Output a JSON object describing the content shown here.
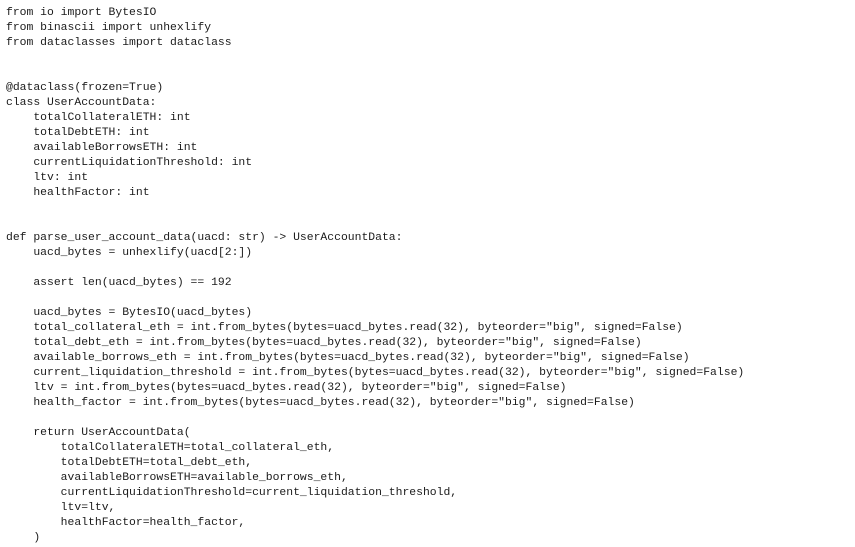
{
  "document": {
    "type": "source-code-listing",
    "language": "python",
    "background_color": "#ffffff",
    "text_color": "#1a1a1a",
    "font_size_px": 11.4,
    "line_height_px": 15,
    "indent_width_spaces": 4,
    "total_lines": 36,
    "code": {
      "lines": [
        "from io import BytesIO",
        "from binascii import unhexlify",
        "from dataclasses import dataclass",
        "",
        "",
        "@dataclass(frozen=True)",
        "class UserAccountData:",
        "    totalCollateralETH: int",
        "    totalDebtETH: int",
        "    availableBorrowsETH: int",
        "    currentLiquidationThreshold: int",
        "    ltv: int",
        "    healthFactor: int",
        "",
        "",
        "def parse_user_account_data(uacd: str) -> UserAccountData:",
        "    uacd_bytes = unhexlify(uacd[2:])",
        "",
        "    assert len(uacd_bytes) == 192",
        "",
        "    uacd_bytes = BytesIO(uacd_bytes)",
        "    total_collateral_eth = int.from_bytes(bytes=uacd_bytes.read(32), byteorder=\"big\", signed=False)",
        "    total_debt_eth = int.from_bytes(bytes=uacd_bytes.read(32), byteorder=\"big\", signed=False)",
        "    available_borrows_eth = int.from_bytes(bytes=uacd_bytes.read(32), byteorder=\"big\", signed=False)",
        "    current_liquidation_threshold = int.from_bytes(bytes=uacd_bytes.read(32), byteorder=\"big\", signed=False)",
        "    ltv = int.from_bytes(bytes=uacd_bytes.read(32), byteorder=\"big\", signed=False)",
        "    health_factor = int.from_bytes(bytes=uacd_bytes.read(32), byteorder=\"big\", signed=False)",
        "",
        "    return UserAccountData(",
        "        totalCollateralETH=total_collateral_eth,",
        "        totalDebtETH=total_debt_eth,",
        "        availableBorrowsETH=available_borrows_eth,",
        "        currentLiquidationThreshold=current_liquidation_threshold,",
        "        ltv=ltv,",
        "        healthFactor=health_factor,",
        "    )"
      ]
    }
  }
}
